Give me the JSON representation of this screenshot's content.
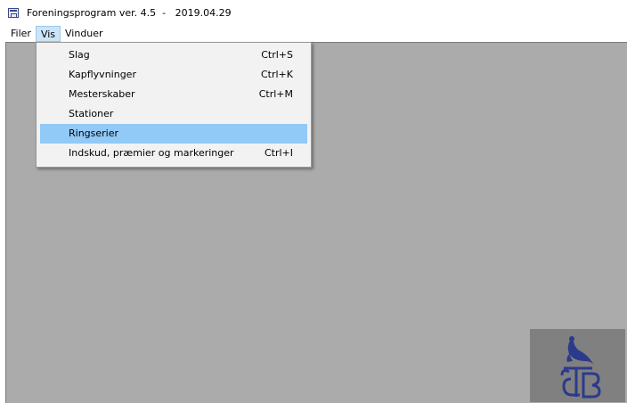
{
  "window": {
    "title": "Foreningsprogram ver. 4.5  -   2019.04.29"
  },
  "menubar": {
    "items": [
      {
        "label": "Filer"
      },
      {
        "label": "Vis"
      },
      {
        "label": "Vinduer"
      }
    ]
  },
  "vis_menu": {
    "items": [
      {
        "label": "Slag",
        "shortcut": "Ctrl+S"
      },
      {
        "label": "Kapflyvninger",
        "shortcut": "Ctrl+K"
      },
      {
        "label": "Mesterskaber",
        "shortcut": "Ctrl+M"
      },
      {
        "label": "Stationer",
        "shortcut": ""
      },
      {
        "label": "Ringserier",
        "shortcut": ""
      },
      {
        "label": "Indskud, præmier og markeringer",
        "shortcut": "Ctrl+I"
      }
    ],
    "highlighted_index": 4
  },
  "colors": {
    "mdi_background": "#ababab",
    "menu_highlight": "#91c9f7",
    "logo_background": "#808080",
    "logo_ink": "#2c3a8c"
  },
  "logo": {
    "icon": "pigeon-logo-icon"
  }
}
